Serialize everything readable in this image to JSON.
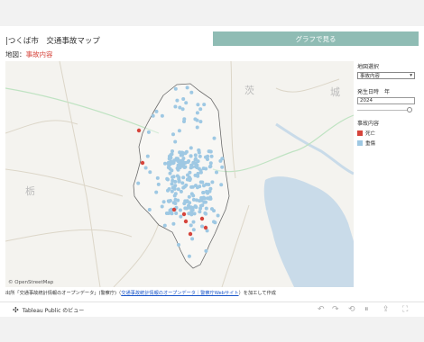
{
  "title": "|つくば市　交通事故マップ",
  "graph_button": "グラフで見る",
  "map_label_prefix": "地図：",
  "map_label_accent": "事故内容",
  "osm_credit": "© OpenStreetMap",
  "map_places": {
    "kanji1": "茨",
    "kanji2": "城",
    "kanji3": "栃"
  },
  "panel": {
    "region_label": "地図選択",
    "region_value": "事故内容",
    "date_label": "発生日時　年",
    "year_value": "2024",
    "legend_title": "事故内容",
    "legend": [
      {
        "label": "死亡",
        "color": "#d6443b"
      },
      {
        "label": "重傷",
        "color": "#9ec8e3"
      }
    ]
  },
  "source": {
    "prefix": "出所「交通事故統計情報のオープンデータ」(警察庁)（",
    "link": "交通事故統計情報のオープンデータ｜警察庁Webサイト",
    "suffix": "）を加工して作成"
  },
  "footer": {
    "tableau": "Tableau Public のビュー",
    "icons": [
      "undo-icon",
      "redo-icon",
      "revert-icon",
      "pause-icon",
      "share-icon",
      "fullscreen-icon"
    ]
  },
  "colors": {
    "accent": "#d6443b",
    "button": "#8fbcb4",
    "dot_blue": "#9ec8e3",
    "dot_red": "#d6443b"
  }
}
